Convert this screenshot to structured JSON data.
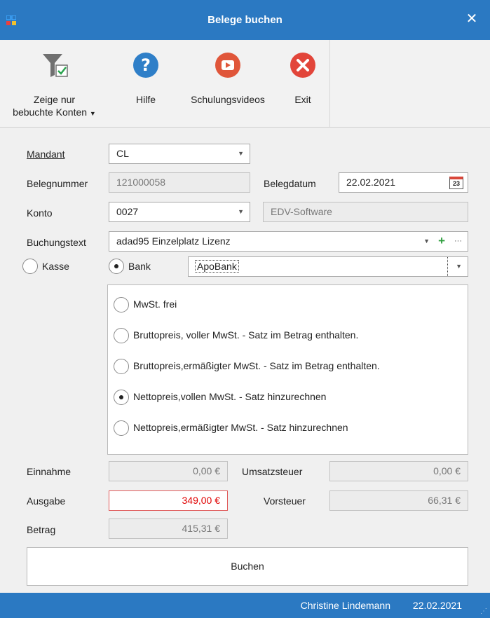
{
  "window": {
    "title": "Belege buchen",
    "close_icon": "close-icon"
  },
  "toolbar": {
    "filter": {
      "label_line1": "Zeige nur",
      "label_line2": "bebuchte Konten",
      "icon": "filter-check-icon"
    },
    "hilfe": {
      "label": "Hilfe",
      "icon": "help-icon"
    },
    "videos": {
      "label": "Schulungsvideos",
      "icon": "video-icon"
    },
    "exit": {
      "label": "Exit",
      "icon": "exit-icon"
    }
  },
  "form": {
    "mandant": {
      "label": "Mandant",
      "value": "CL"
    },
    "belegnummer": {
      "label": "Belegnummer",
      "value": "121000058"
    },
    "belegdatum": {
      "label": "Belegdatum",
      "value": "22.02.2021",
      "calendar_day": "23"
    },
    "konto": {
      "label": "Konto",
      "value": "0027",
      "name": "EDV-Software"
    },
    "buchungstext": {
      "label": "Buchungstext",
      "value": "adad95 Einzelplatz Lizenz",
      "add_glyph": "+",
      "more_glyph": "···"
    },
    "kasse": {
      "label": "Kasse",
      "selected": false
    },
    "bank": {
      "label": "Bank",
      "selected": true,
      "value": "ApoBank"
    },
    "mwst_options": [
      {
        "label": "MwSt. frei",
        "selected": false
      },
      {
        "label": "Bruttopreis, voller MwSt. - Satz im Betrag enthalten.",
        "selected": false
      },
      {
        "label": "Bruttopreis,ermäßigter MwSt. - Satz im Betrag enthalten.",
        "selected": false
      },
      {
        "label": "Nettopreis,vollen MwSt. - Satz hinzurechnen",
        "selected": true
      },
      {
        "label": "Nettopreis,ermäßigter MwSt. - Satz hinzurechnen",
        "selected": false
      }
    ],
    "einnahme": {
      "label": "Einnahme",
      "value": "0,00 €"
    },
    "umsatzsteuer": {
      "label": "Umsatzsteuer",
      "value": "0,00 €"
    },
    "ausgabe": {
      "label": "Ausgabe",
      "value": "349,00 €"
    },
    "vorsteuer": {
      "label": "Vorsteuer",
      "value": "66,31 €"
    },
    "betrag": {
      "label": "Betrag",
      "value": "415,31 €"
    },
    "buchen_label": "Buchen"
  },
  "status": {
    "user": "Christine Lindemann",
    "date": "22.02.2021"
  },
  "colors": {
    "accent": "#2b79c2",
    "alert": "#e00000",
    "add": "#2e9e3e"
  }
}
